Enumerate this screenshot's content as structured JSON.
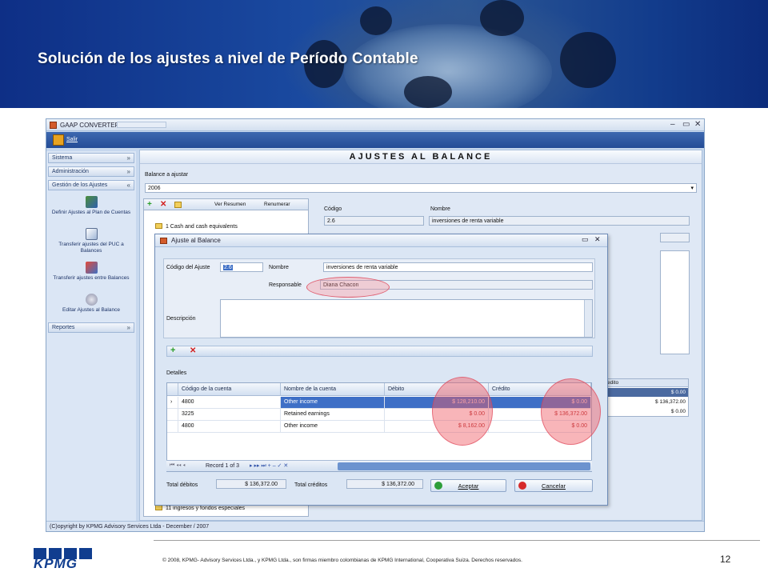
{
  "slide": {
    "title": "Solución de los ajustes a nivel de Período Contable",
    "copyright": "© 2008, KPMG- Advisory Services Ltda., y KPMG Ltda., son firmas miembro colombianas  de KPMG International,  Cooperativa  Suiza.  Derechos reservados.",
    "page_number": "12",
    "logo_text": "KPMG"
  },
  "app": {
    "title": "GAAP CONVERTER -",
    "toolbar": {
      "salir": "Salir"
    },
    "window_controls": {
      "minimize": "–",
      "restore": "▭",
      "close": "✕"
    },
    "status": "(C)opyright by KPMG Advisory Services Ltda - December / 2007"
  },
  "nav": {
    "sections": [
      {
        "label": "Sistema"
      },
      {
        "label": "Administración"
      },
      {
        "label": "Gestión de los Ajustes"
      },
      {
        "label": "Reportes"
      }
    ],
    "items": [
      {
        "label": "Definir Ajustes al Plan de Cuentas"
      },
      {
        "label": "Transferir ajustes del PUC a Balances"
      },
      {
        "label": "Transferir ajustes entre Balances"
      },
      {
        "label": "Editar Ajustes al Balance"
      }
    ]
  },
  "main": {
    "header": "AJUSTES AL BALANCE",
    "balance_label": "Balance a ajustar",
    "balance_value": "2006",
    "tree_toolbar": {
      "ver_resumen": "Ver Resumen",
      "renumerar": "Renumerar"
    },
    "tree_items": [
      "1 Cash and cash equivalents",
      "11 ingresos y fondos especiales"
    ],
    "codigo_label": "Código",
    "nombre_label": "Nombre",
    "codigo_value": "2.6",
    "nombre_value": "inversiones de renta variable",
    "right_grid": {
      "header": "edito",
      "rows": [
        "$ 0.00",
        "$ 136,372.00",
        "$ 0.00"
      ]
    }
  },
  "dialog": {
    "title": "Ajuste al Balance",
    "codigo_label": "Código del Ajuste",
    "codigo_value": "2.6",
    "nombre_label": "Nombre",
    "nombre_value": "inversiones de renta variable",
    "responsable_label": "Responsable",
    "responsable_value": "Diana Chacon",
    "descripcion_label": "Descripción",
    "detalles_label": "Detalles",
    "grid": {
      "columns": [
        "Código de la cuenta",
        "Nombre de la cuenta",
        "Débito",
        "Crédito"
      ],
      "rows": [
        {
          "codigo": "4800",
          "nombre": "Other income",
          "debito": "$ 128,210.00",
          "credito": "$ 0.00"
        },
        {
          "codigo": "3225",
          "nombre": "Retained earnings",
          "debito": "$ 0.00",
          "credito": "$ 136,372.00"
        },
        {
          "codigo": "4800",
          "nombre": "Other income",
          "debito": "$ 8,162.00",
          "credito": "$ 0.00"
        }
      ]
    },
    "record_nav": "Record 1 of 3",
    "total_debitos_label": "Total débitos",
    "total_debitos_value": "$ 136,372.00",
    "total_creditos_label": "Total créditos",
    "total_creditos_value": "$ 136,372.00",
    "aceptar": "Aceptar",
    "cancelar": "Cancelar"
  },
  "colors": {
    "accent": "#244c96",
    "highlight": "#f05a64",
    "kpmg_blue": "#103d8f"
  }
}
